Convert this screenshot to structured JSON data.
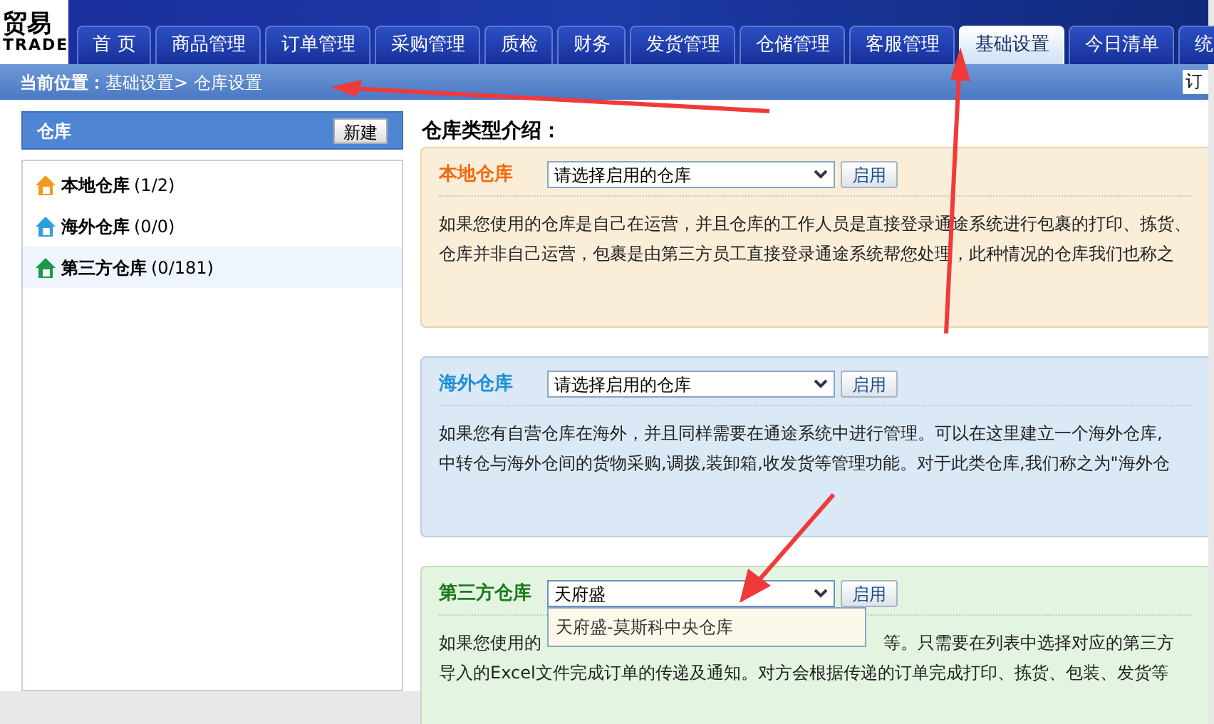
{
  "logo": {
    "top": "贸易",
    "bottom": "TRADE"
  },
  "tabs": [
    {
      "label": "首 页",
      "selected": false
    },
    {
      "label": "商品管理",
      "selected": false
    },
    {
      "label": "订单管理",
      "selected": false
    },
    {
      "label": "采购管理",
      "selected": false
    },
    {
      "label": "质检",
      "selected": false
    },
    {
      "label": "财务",
      "selected": false
    },
    {
      "label": "发货管理",
      "selected": false
    },
    {
      "label": "仓储管理",
      "selected": false
    },
    {
      "label": "客服管理",
      "selected": false
    },
    {
      "label": "基础设置",
      "selected": true
    },
    {
      "label": "今日清单",
      "selected": false
    },
    {
      "label": "统",
      "selected": false
    }
  ],
  "breadcrumb": {
    "label": "当前位置：",
    "path": "基础设置> 仓库设置"
  },
  "search_field": {
    "value": "订"
  },
  "sidebar": {
    "title": "仓库",
    "new_button": "新建",
    "items": [
      {
        "label": "本地仓库",
        "count": "(1/2)",
        "color": "#f39a1e",
        "selected": false
      },
      {
        "label": "海外仓库",
        "count": "(0/0)",
        "color": "#2a9ee0",
        "selected": false
      },
      {
        "label": "第三方仓库",
        "count": "(0/181)",
        "color": "#1a9a4a",
        "selected": true
      }
    ]
  },
  "main": {
    "title": "仓库类型介绍：",
    "sections": [
      {
        "kind": "local",
        "name": "本地仓库",
        "select": {
          "value": "请选择启用的仓库",
          "open": false
        },
        "enable_button": "启用",
        "lines": [
          [
            "如果您使用的仓库是自己在运营，并且仓库的工作人员是直接登录通途系统进行包裹的打印、拣货、"
          ],
          [
            "仓库并非自己运营，包裹是由第三方员工直接登录通途系统帮您处理，此种情况的仓库我们也称之"
          ]
        ]
      },
      {
        "kind": "overseas",
        "name": "海外仓库",
        "select": {
          "value": "请选择启用的仓库",
          "open": false
        },
        "enable_button": "启用",
        "lines": [
          [
            "如果您有自营仓库在海外，并且同样需要在通途系统中进行管理。可以在这里建立一个海外仓库,"
          ],
          [
            "中转仓与海外仓间的货物采购,调拨,装卸箱,收发货等管理功能。对于此类仓库,我们称之为\"海外仓"
          ]
        ]
      },
      {
        "kind": "third_party",
        "name": "第三方仓库",
        "select": {
          "value": "天府盛",
          "open": true,
          "options": [
            "天府盛-莫斯科中央仓库"
          ]
        },
        "enable_button": "启用",
        "lines": [
          [
            "如果您使用的",
            "等。只需要在列表中选择对应的第三方"
          ],
          [
            "导入的Excel文件完成订单的传递及通知。对方会根据传递的订单完成打印、拣货、包装、发货等"
          ]
        ]
      }
    ]
  }
}
